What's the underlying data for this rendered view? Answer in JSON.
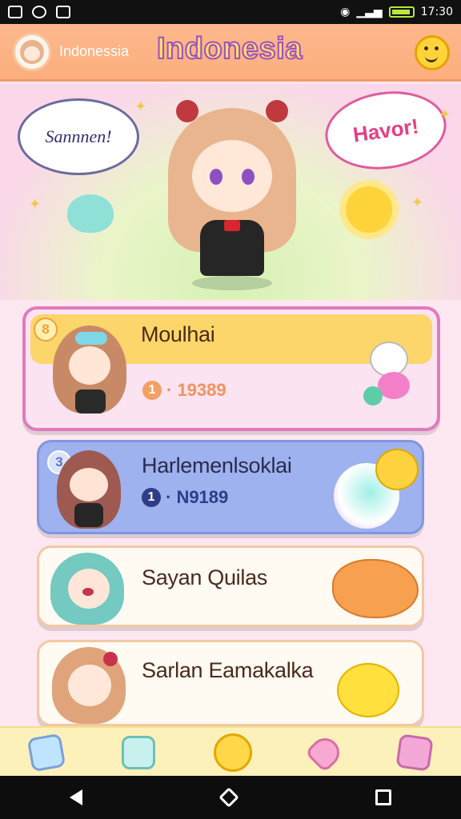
{
  "status": {
    "time": "17:30"
  },
  "app": {
    "subtitle": "Indonessia",
    "title": "Indonesia"
  },
  "hero": {
    "bubble_left": "Sannnen!",
    "bubble_right": "Havor!"
  },
  "cards": [
    {
      "rank": "8",
      "name": "Moulhai",
      "score_badge": "1",
      "score": "· 19389"
    },
    {
      "rank": "3",
      "name": "Harlemenlsoklai",
      "score_badge": "1",
      "score": "· N9189"
    },
    {
      "name": "Sayan Quilas"
    },
    {
      "name": "Sarlan Eamakalka"
    }
  ]
}
